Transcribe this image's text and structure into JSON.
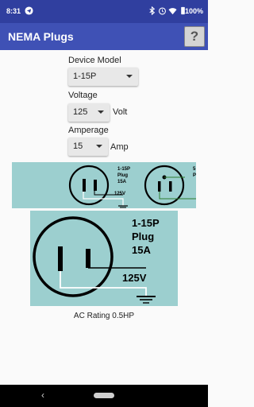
{
  "status": {
    "time": "8:31",
    "battery": "100%"
  },
  "app": {
    "title": "NEMA Plugs",
    "help_label": "?"
  },
  "device": {
    "label": "Device Model",
    "value": "1-15P"
  },
  "voltage": {
    "label": "Voltage",
    "value": "125",
    "unit": "Volt"
  },
  "amperage": {
    "label": "Amperage",
    "value": "15",
    "unit": "Amp"
  },
  "strip": {
    "plug_label_1": "1-15P",
    "plug_label_2": "Plug",
    "plug_label_3": "15A",
    "plug_voltage": "125V",
    "next_label_partial_1": "5",
    "next_label_partial_2": "P"
  },
  "diagram": {
    "line1": "1-15P",
    "line2": "Plug",
    "line3": "15A",
    "voltage": "125V"
  },
  "rating": "AC Rating 0.5HP",
  "nav": {
    "back_glyph": "‹"
  }
}
